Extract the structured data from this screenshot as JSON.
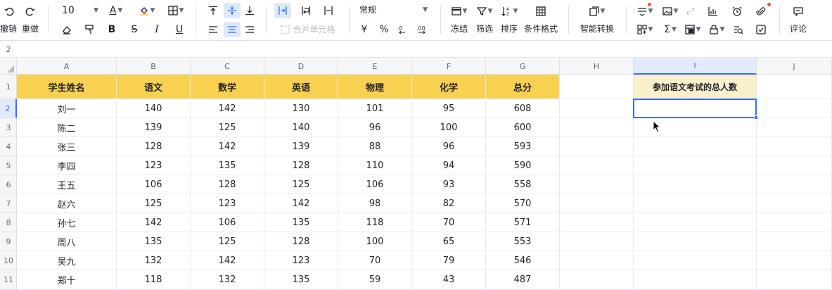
{
  "toolbar": {
    "undo_label": "撤销",
    "redo_label": "重做",
    "font_size": "10",
    "bold": "B",
    "italic": "I",
    "underline": "U",
    "strike": "S",
    "font_color_glyph": "A",
    "merge_label": "合并单元格",
    "number_format": "常规",
    "currency": "¥",
    "percent": "%",
    "freeze_label": "冻结",
    "filter_label": "筛选",
    "sort_label": "排序",
    "cond_format_label": "条件格式",
    "smart_convert_label": "智能转换",
    "comment_label": "评论",
    "sum_glyph": "Σ"
  },
  "grid": {
    "hidden_row_label": "2",
    "columns": [
      "A",
      "B",
      "C",
      "D",
      "E",
      "F",
      "G",
      "H",
      "I",
      "J"
    ],
    "selected_column": "I",
    "row_numbers": [
      "1",
      "2",
      "3",
      "4",
      "5",
      "6",
      "7",
      "8",
      "9",
      "10",
      "11"
    ],
    "selected_row": "2",
    "headers": [
      "学生姓名",
      "语文",
      "数学",
      "英语",
      "物理",
      "化学",
      "总分"
    ],
    "i_header": "参加语文考试的总人数",
    "rows": [
      [
        "刘一",
        "140",
        "142",
        "130",
        "101",
        "95",
        "608"
      ],
      [
        "陈二",
        "139",
        "125",
        "140",
        "96",
        "100",
        "600"
      ],
      [
        "张三",
        "128",
        "142",
        "139",
        "88",
        "96",
        "593"
      ],
      [
        "李四",
        "123",
        "135",
        "128",
        "110",
        "94",
        "590"
      ],
      [
        "王五",
        "106",
        "128",
        "125",
        "106",
        "93",
        "558"
      ],
      [
        "赵六",
        "125",
        "123",
        "142",
        "98",
        "82",
        "570"
      ],
      [
        "孙七",
        "142",
        "106",
        "135",
        "118",
        "70",
        "571"
      ],
      [
        "周八",
        "135",
        "125",
        "128",
        "100",
        "65",
        "553"
      ],
      [
        "吴九",
        "132",
        "142",
        "123",
        "70",
        "79",
        "546"
      ],
      [
        "郑十",
        "118",
        "132",
        "135",
        "59",
        "43",
        "487"
      ]
    ]
  },
  "colors": {
    "header_fill": "#f8d150",
    "i_header_fill": "#faf0cc",
    "selection": "#3370ff"
  }
}
